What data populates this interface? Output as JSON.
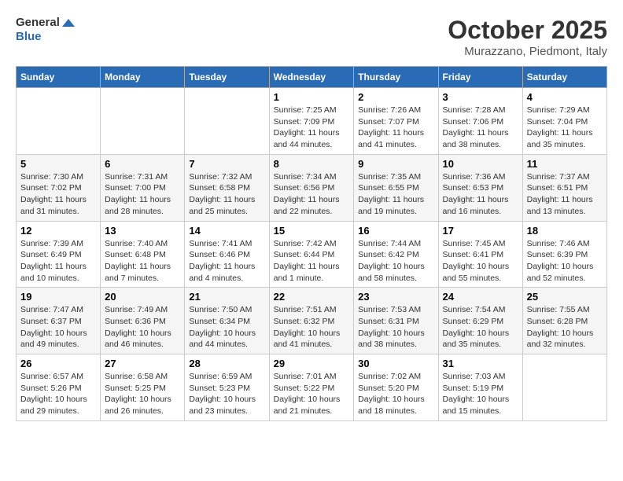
{
  "logo": {
    "general": "General",
    "blue": "Blue"
  },
  "title": "October 2025",
  "location": "Murazzano, Piedmont, Italy",
  "days_of_week": [
    "Sunday",
    "Monday",
    "Tuesday",
    "Wednesday",
    "Thursday",
    "Friday",
    "Saturday"
  ],
  "weeks": [
    [
      {
        "day": "",
        "info": ""
      },
      {
        "day": "",
        "info": ""
      },
      {
        "day": "",
        "info": ""
      },
      {
        "day": "1",
        "info": "Sunrise: 7:25 AM\nSunset: 7:09 PM\nDaylight: 11 hours and 44 minutes."
      },
      {
        "day": "2",
        "info": "Sunrise: 7:26 AM\nSunset: 7:07 PM\nDaylight: 11 hours and 41 minutes."
      },
      {
        "day": "3",
        "info": "Sunrise: 7:28 AM\nSunset: 7:06 PM\nDaylight: 11 hours and 38 minutes."
      },
      {
        "day": "4",
        "info": "Sunrise: 7:29 AM\nSunset: 7:04 PM\nDaylight: 11 hours and 35 minutes."
      }
    ],
    [
      {
        "day": "5",
        "info": "Sunrise: 7:30 AM\nSunset: 7:02 PM\nDaylight: 11 hours and 31 minutes."
      },
      {
        "day": "6",
        "info": "Sunrise: 7:31 AM\nSunset: 7:00 PM\nDaylight: 11 hours and 28 minutes."
      },
      {
        "day": "7",
        "info": "Sunrise: 7:32 AM\nSunset: 6:58 PM\nDaylight: 11 hours and 25 minutes."
      },
      {
        "day": "8",
        "info": "Sunrise: 7:34 AM\nSunset: 6:56 PM\nDaylight: 11 hours and 22 minutes."
      },
      {
        "day": "9",
        "info": "Sunrise: 7:35 AM\nSunset: 6:55 PM\nDaylight: 11 hours and 19 minutes."
      },
      {
        "day": "10",
        "info": "Sunrise: 7:36 AM\nSunset: 6:53 PM\nDaylight: 11 hours and 16 minutes."
      },
      {
        "day": "11",
        "info": "Sunrise: 7:37 AM\nSunset: 6:51 PM\nDaylight: 11 hours and 13 minutes."
      }
    ],
    [
      {
        "day": "12",
        "info": "Sunrise: 7:39 AM\nSunset: 6:49 PM\nDaylight: 11 hours and 10 minutes."
      },
      {
        "day": "13",
        "info": "Sunrise: 7:40 AM\nSunset: 6:48 PM\nDaylight: 11 hours and 7 minutes."
      },
      {
        "day": "14",
        "info": "Sunrise: 7:41 AM\nSunset: 6:46 PM\nDaylight: 11 hours and 4 minutes."
      },
      {
        "day": "15",
        "info": "Sunrise: 7:42 AM\nSunset: 6:44 PM\nDaylight: 11 hours and 1 minute."
      },
      {
        "day": "16",
        "info": "Sunrise: 7:44 AM\nSunset: 6:42 PM\nDaylight: 10 hours and 58 minutes."
      },
      {
        "day": "17",
        "info": "Sunrise: 7:45 AM\nSunset: 6:41 PM\nDaylight: 10 hours and 55 minutes."
      },
      {
        "day": "18",
        "info": "Sunrise: 7:46 AM\nSunset: 6:39 PM\nDaylight: 10 hours and 52 minutes."
      }
    ],
    [
      {
        "day": "19",
        "info": "Sunrise: 7:47 AM\nSunset: 6:37 PM\nDaylight: 10 hours and 49 minutes."
      },
      {
        "day": "20",
        "info": "Sunrise: 7:49 AM\nSunset: 6:36 PM\nDaylight: 10 hours and 46 minutes."
      },
      {
        "day": "21",
        "info": "Sunrise: 7:50 AM\nSunset: 6:34 PM\nDaylight: 10 hours and 44 minutes."
      },
      {
        "day": "22",
        "info": "Sunrise: 7:51 AM\nSunset: 6:32 PM\nDaylight: 10 hours and 41 minutes."
      },
      {
        "day": "23",
        "info": "Sunrise: 7:53 AM\nSunset: 6:31 PM\nDaylight: 10 hours and 38 minutes."
      },
      {
        "day": "24",
        "info": "Sunrise: 7:54 AM\nSunset: 6:29 PM\nDaylight: 10 hours and 35 minutes."
      },
      {
        "day": "25",
        "info": "Sunrise: 7:55 AM\nSunset: 6:28 PM\nDaylight: 10 hours and 32 minutes."
      }
    ],
    [
      {
        "day": "26",
        "info": "Sunrise: 6:57 AM\nSunset: 5:26 PM\nDaylight: 10 hours and 29 minutes."
      },
      {
        "day": "27",
        "info": "Sunrise: 6:58 AM\nSunset: 5:25 PM\nDaylight: 10 hours and 26 minutes."
      },
      {
        "day": "28",
        "info": "Sunrise: 6:59 AM\nSunset: 5:23 PM\nDaylight: 10 hours and 23 minutes."
      },
      {
        "day": "29",
        "info": "Sunrise: 7:01 AM\nSunset: 5:22 PM\nDaylight: 10 hours and 21 minutes."
      },
      {
        "day": "30",
        "info": "Sunrise: 7:02 AM\nSunset: 5:20 PM\nDaylight: 10 hours and 18 minutes."
      },
      {
        "day": "31",
        "info": "Sunrise: 7:03 AM\nSunset: 5:19 PM\nDaylight: 10 hours and 15 minutes."
      },
      {
        "day": "",
        "info": ""
      }
    ]
  ]
}
